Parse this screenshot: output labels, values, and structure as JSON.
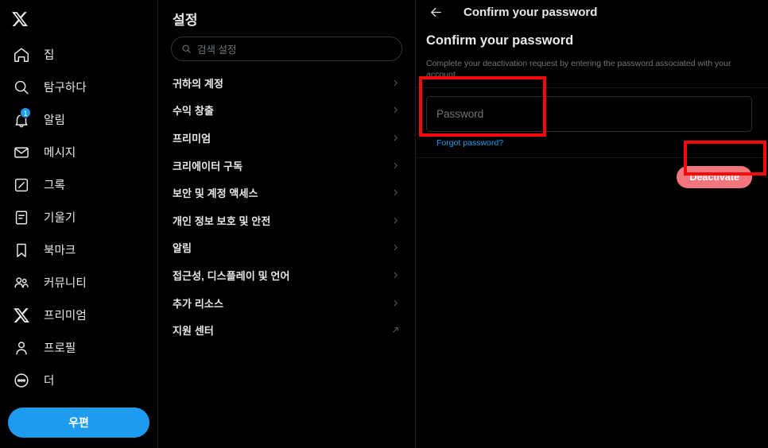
{
  "left_nav": {
    "logo": "x-logo",
    "items": [
      {
        "label": "집",
        "icon": "home-icon",
        "badge": null
      },
      {
        "label": "탐구하다",
        "icon": "search-icon",
        "badge": null
      },
      {
        "label": "알림",
        "icon": "bell-icon",
        "badge": "1"
      },
      {
        "label": "메시지",
        "icon": "envelope-icon",
        "badge": null
      },
      {
        "label": "그록",
        "icon": "grok-icon",
        "badge": null
      },
      {
        "label": "기울기",
        "icon": "list-icon",
        "badge": null
      },
      {
        "label": "북마크",
        "icon": "bookmark-icon",
        "badge": null
      },
      {
        "label": "커뮤니티",
        "icon": "communities-icon",
        "badge": null
      },
      {
        "label": "프리미엄",
        "icon": "x-premium-icon",
        "badge": null
      },
      {
        "label": "프로필",
        "icon": "person-icon",
        "badge": null
      },
      {
        "label": "더",
        "icon": "more-circle-icon",
        "badge": null
      }
    ],
    "post_button": "우편"
  },
  "settings": {
    "title": "설정",
    "search": {
      "placeholder": "검색 설정",
      "value": "",
      "icon": "search-icon"
    },
    "items": [
      {
        "label": "귀하의 계정",
        "arrow": "chevron-right-icon"
      },
      {
        "label": "수익 창출",
        "arrow": "chevron-right-icon"
      },
      {
        "label": "프리미엄",
        "arrow": "chevron-right-icon"
      },
      {
        "label": "크리에이터 구독",
        "arrow": "chevron-right-icon"
      },
      {
        "label": "보안 및 계정 액세스",
        "arrow": "chevron-right-icon"
      },
      {
        "label": "개인 정보 보호 및 안전",
        "arrow": "chevron-right-icon"
      },
      {
        "label": "알림",
        "arrow": "chevron-right-icon"
      },
      {
        "label": "접근성, 디스플레이 및 언어",
        "arrow": "chevron-right-icon"
      },
      {
        "label": "추가 리소스",
        "arrow": "chevron-right-icon"
      },
      {
        "label": "지원 센터",
        "arrow": "external-link-icon"
      }
    ]
  },
  "detail": {
    "back_icon": "back-arrow-icon",
    "header_title": "Confirm your password",
    "heading": "Confirm your password",
    "description": "Complete your deactivation request by entering the password associated with your account.",
    "password_field": {
      "placeholder": "Password",
      "value": ""
    },
    "forgot_link": "Forgot password?",
    "deactivate_button": "Deactivate"
  },
  "colors": {
    "background": "#000000",
    "text_primary": "#e7e9ea",
    "text_secondary": "#71767b",
    "accent_blue": "#1d9bf0",
    "deactivate_red": "#f4767d",
    "annotation_red": "#f50a0a",
    "divider": "#16181c"
  }
}
